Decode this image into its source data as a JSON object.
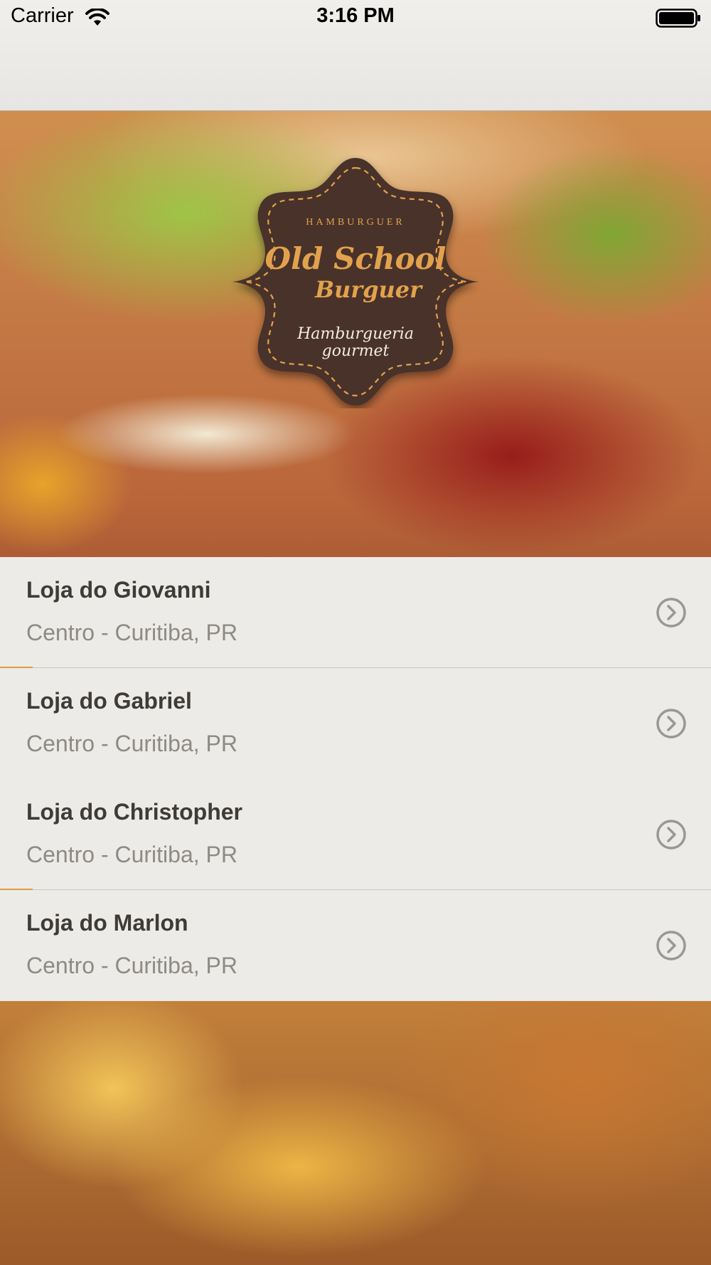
{
  "status_bar": {
    "carrier": "Carrier",
    "time": "3:16 PM",
    "icons": [
      "wifi-icon",
      "battery-icon"
    ]
  },
  "logo": {
    "top_text": "HAMBURGUER",
    "title_line1": "Old School",
    "title_line2": "Burguer",
    "tagline_line1": "Hamburgueria",
    "tagline_line2": "gourmet",
    "colors": {
      "badge": "#4a3329",
      "accent": "#e2a24d",
      "text_light": "#f3ece2"
    }
  },
  "stores": [
    {
      "name": "Loja do Giovanni",
      "location": "Centro - Curitiba, PR"
    },
    {
      "name": "Loja do Gabriel",
      "location": "Centro - Curitiba, PR"
    },
    {
      "name": "Loja do Christopher",
      "location": "Centro - Curitiba, PR"
    },
    {
      "name": "Loja do Marlon",
      "location": "Centro - Curitiba, PR"
    }
  ],
  "colors": {
    "row_background": "#ecebe7",
    "title_text": "#3f3b37",
    "subtitle_text": "#8e8a86",
    "chevron": "#9a9794",
    "separator_accent": "#e39a3d"
  }
}
